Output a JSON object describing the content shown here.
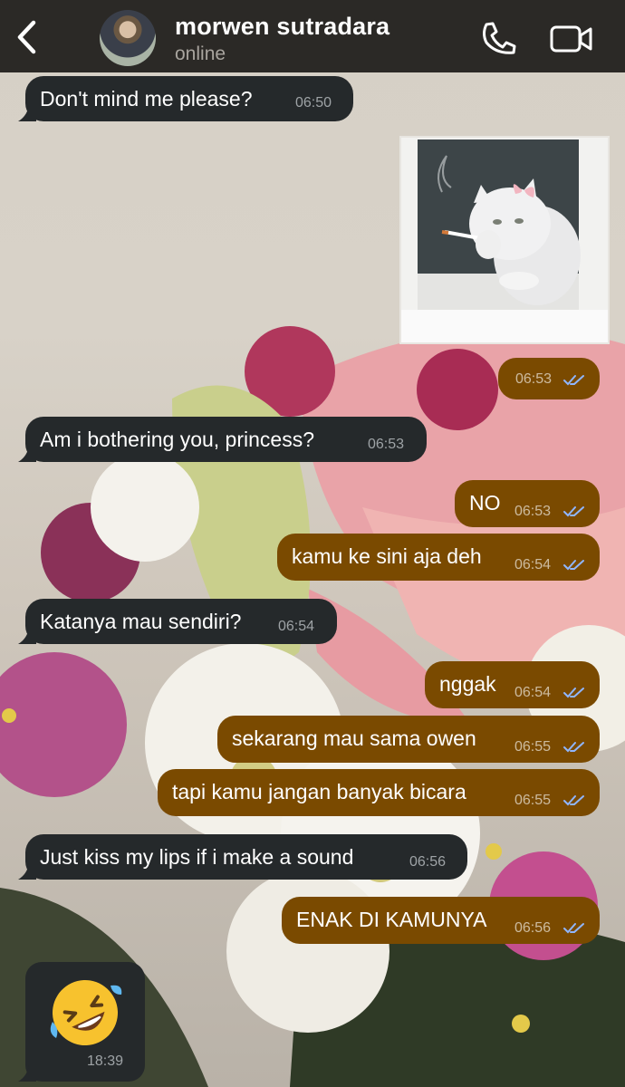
{
  "header": {
    "contact_name": "morwen sutradara",
    "status": "online",
    "back_icon": "chevron-left-icon",
    "call_icon": "phone-icon",
    "video_icon": "video-camera-icon"
  },
  "colors": {
    "header_bg": "#2b2926",
    "incoming_bubble": "#25292b",
    "outgoing_bubble": "#7a4a00",
    "read_ticks": "#8fb6ff"
  },
  "messages": [
    {
      "dir": "in",
      "text": "Don't mind me please?",
      "time": "06:50"
    },
    {
      "dir": "out",
      "type": "image",
      "image": "cat-with-cigarette-sticker",
      "time": "06:53",
      "read": true
    },
    {
      "dir": "in",
      "text": "Am i bothering you, princess?",
      "time": "06:53"
    },
    {
      "dir": "out",
      "text": "NO",
      "time": "06:53",
      "read": true
    },
    {
      "dir": "out",
      "text": "kamu ke sini aja deh",
      "time": "06:54",
      "read": true
    },
    {
      "dir": "in",
      "text": "Katanya mau sendiri?",
      "time": "06:54"
    },
    {
      "dir": "out",
      "text": "nggak",
      "time": "06:54",
      "read": true
    },
    {
      "dir": "out",
      "text": "sekarang mau sama owen",
      "time": "06:55",
      "read": true
    },
    {
      "dir": "out",
      "text": "tapi kamu jangan banyak bicara",
      "time": "06:55",
      "read": true
    },
    {
      "dir": "in",
      "text": "Just kiss my lips if i make a sound",
      "time": "06:56"
    },
    {
      "dir": "out",
      "text": "ENAK DI KAMUNYA",
      "time": "06:56",
      "read": true
    },
    {
      "dir": "in",
      "type": "emoji",
      "emoji": "🤣",
      "time": "18:39"
    }
  ]
}
